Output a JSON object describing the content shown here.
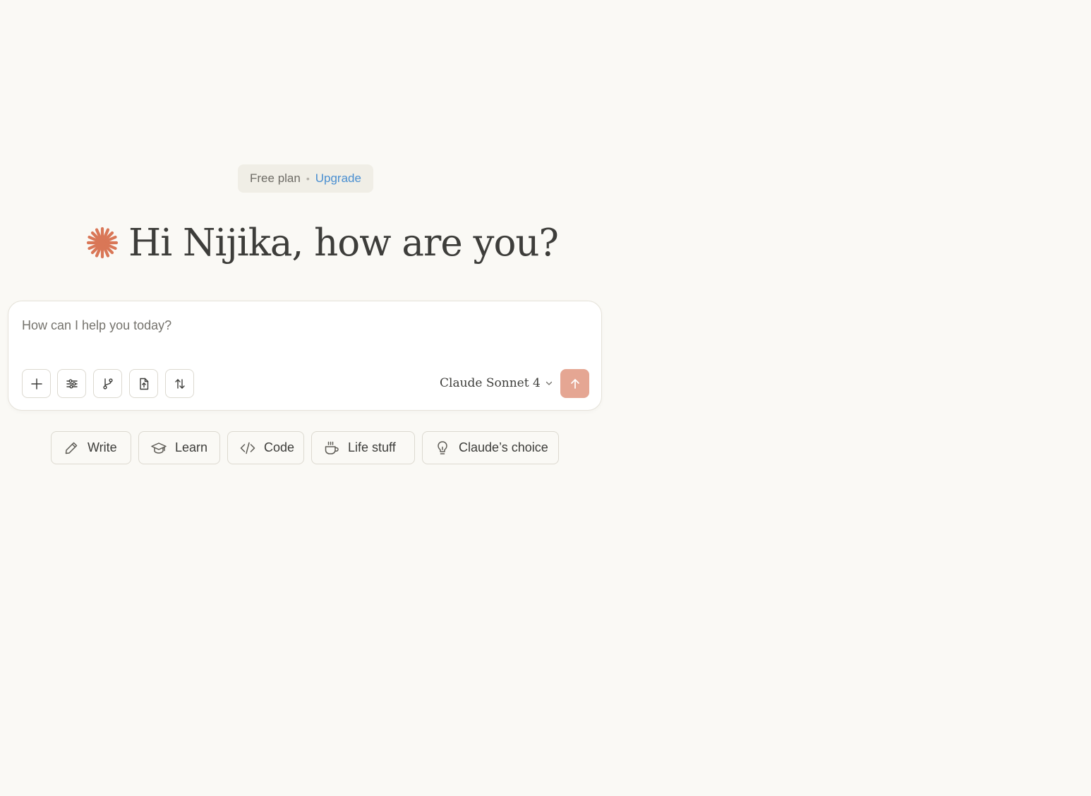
{
  "plan_badge": {
    "plan_label": "Free plan",
    "separator": "•",
    "upgrade_label": "Upgrade"
  },
  "greeting": {
    "text": "Hi Nijika, how are you?",
    "icon": "spark-icon"
  },
  "composer": {
    "value": "",
    "placeholder": "How can I help you today?",
    "tools": [
      {
        "name": "add-content",
        "icon": "plus-icon"
      },
      {
        "name": "search-and-tools",
        "icon": "sliders-icon"
      },
      {
        "name": "connect-repo",
        "icon": "git-branch-icon"
      },
      {
        "name": "upload-file",
        "icon": "file-upload-icon"
      },
      {
        "name": "sort-toggle",
        "icon": "arrows-up-down-icon"
      }
    ],
    "model_label": "Claude Sonnet 4",
    "send_icon": "arrow-up-icon"
  },
  "suggestions": [
    {
      "label": "Write",
      "icon": "pencil-icon"
    },
    {
      "label": "Learn",
      "icon": "graduation-cap-icon"
    },
    {
      "label": "Code",
      "icon": "code-icon"
    },
    {
      "label": "Life stuff",
      "icon": "coffee-cup-icon"
    },
    {
      "label": "Claude’s choice",
      "icon": "lightbulb-icon"
    }
  ],
  "colors": {
    "background": "#faf9f5",
    "accent": "#d97757",
    "send_button": "#e5a693",
    "link": "#4a8fd1",
    "text": "#3d3d3a"
  }
}
